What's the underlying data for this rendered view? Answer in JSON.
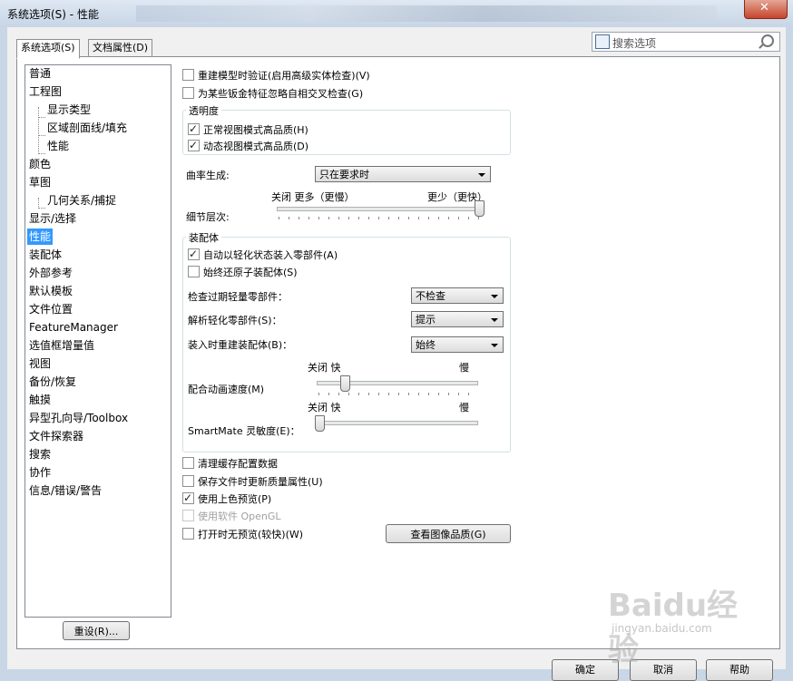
{
  "window": {
    "title": "系统选项(S) - 性能",
    "close_label": "✕"
  },
  "tabs": [
    {
      "label": "系统选项(S)",
      "active": true
    },
    {
      "label": "文档属性(D)",
      "active": false
    }
  ],
  "search": {
    "placeholder": "搜索选项"
  },
  "tree": {
    "items": [
      "普通",
      "工程图",
      "显示类型",
      "区域剖面线/填充",
      "性能",
      "颜色",
      "草图",
      "几何关系/捕捉",
      "显示/选择",
      "性能",
      "装配体",
      "外部参考",
      "默认模板",
      "文件位置",
      "FeatureManager",
      "选值框增量值",
      "视图",
      "备份/恢复",
      "触摸",
      "异型孔向导/Toolbox",
      "文件探索器",
      "搜索",
      "协作",
      "信息/错误/警告"
    ],
    "selected_index": 9,
    "reset_button": "重设(R)..."
  },
  "options": {
    "rebuild_verify": "重建模型时验证(启用高级实体检查)(V)",
    "ignore_self_intersect": "为某些钣金特征忽略自相交叉检查(G)",
    "transparency": {
      "title": "透明度",
      "normal_view_hq": "正常视图模式高品质(H)",
      "dynamic_view_hq": "动态视图模式高品质(D)"
    },
    "curvature": {
      "label": "曲率生成:",
      "value": "只在要求时"
    },
    "level_of_detail": {
      "label": "细节层次:",
      "left": "关闭 更多（更慢）",
      "right": "更少（更快）",
      "level": 1.0
    },
    "assemblies": {
      "title": "装配体",
      "auto_lightweight": "自动以轻化状态装入零部件(A)",
      "always_resolve": "始终还原子装配体(S)",
      "check_outdated": {
        "label": "检查过期轻量零部件：",
        "value": "不检查"
      },
      "resolve_lightweight": {
        "label": "解析轻化零部件(S)：",
        "value": "提示"
      },
      "rebuild_on_load": {
        "label": "装入时重建装配体(B)：",
        "value": "始终"
      },
      "mate_animation": {
        "label": "配合动画速度(M)",
        "off_fast": "关闭 快",
        "slow": "慢",
        "level": 0.2
      },
      "smartmate": {
        "label": "SmartMate 灵敏度(E)：",
        "off_fast": "关闭 快",
        "slow": "慢",
        "level": 0.0
      }
    },
    "purge_cache": "清理缓存配置数据",
    "update_mass": "保存文件时更新质量属性(U)",
    "shaded_preview": "使用上色预览(P)",
    "software_opengl": "使用软件 OpenGL",
    "no_preview": "打开时无预览(较快)(W)",
    "image_quality_button": "查看图像品质(G)"
  },
  "footer": {
    "ok": "确定",
    "cancel": "取消",
    "help": "帮助"
  },
  "watermark": {
    "logo": "Baidu经验",
    "url": "jingyan.baidu.com"
  }
}
